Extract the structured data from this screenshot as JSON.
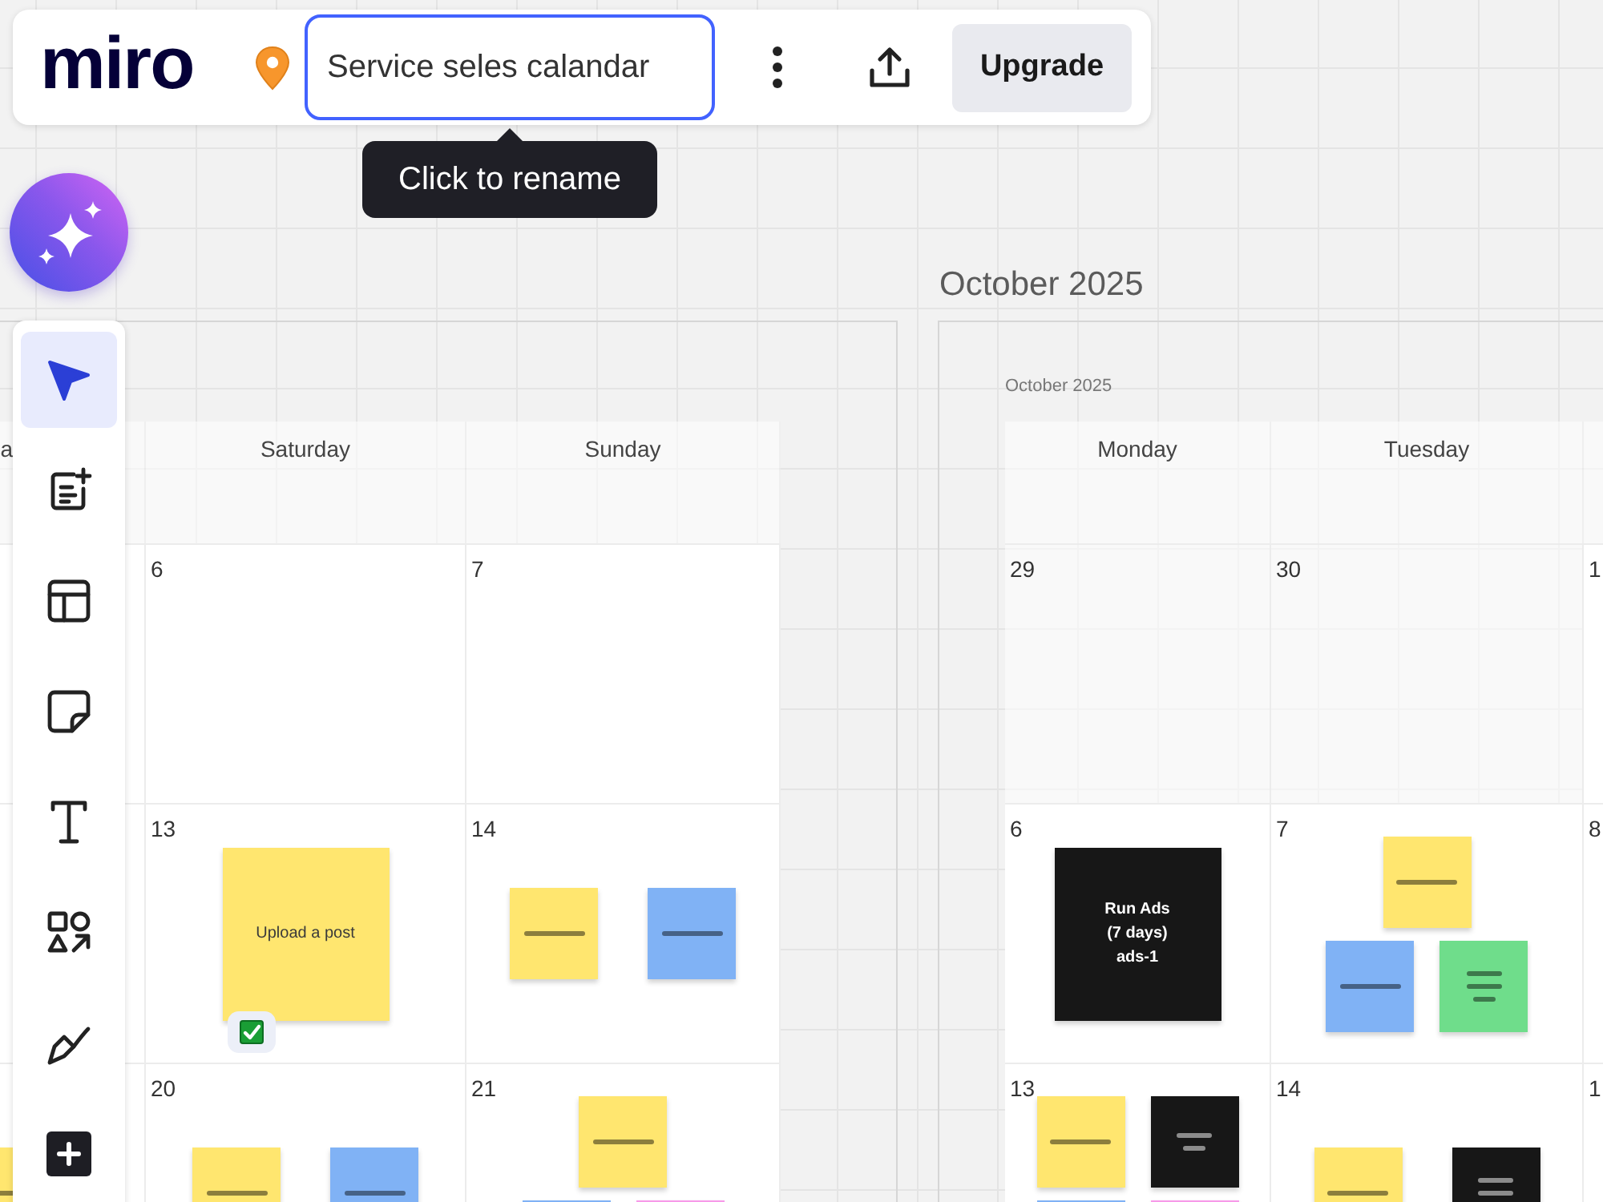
{
  "top_bar": {
    "logo": "miro",
    "board_title": "Service seles calandar",
    "upgrade_button": "Upgrade"
  },
  "tooltip": "Click to rename",
  "toolbar": [
    {
      "kind": "select",
      "selected": true
    },
    {
      "kind": "note",
      "selected": false
    },
    {
      "kind": "layout",
      "selected": false
    },
    {
      "kind": "sticky",
      "selected": false
    },
    {
      "kind": "text",
      "selected": false
    },
    {
      "kind": "shapes",
      "selected": false
    },
    {
      "kind": "pen",
      "selected": false
    },
    {
      "kind": "add",
      "selected": false
    }
  ],
  "frames": [
    {
      "columns": [
        {
          "header": "a"
        },
        {
          "header": "Saturday"
        },
        {
          "header": "Sunday"
        }
      ],
      "weeks": [
        [
          {
            "other_month": false
          },
          {
            "day": "6",
            "other_month": false
          },
          {
            "day": "7",
            "other_month": false
          }
        ],
        [
          {
            "other_month": false
          },
          {
            "day": "13",
            "other_month": false,
            "note_rows": [
              [
                {
                  "kind": "text",
                  "color": "#ffe66f",
                  "text": "Upload a post",
                  "checked": true
                }
              ]
            ]
          },
          {
            "day": "14",
            "other_month": false,
            "note_rows": [
              [
                {
                  "kind": "line",
                  "color": "#ffe66f",
                  "checked": false
                },
                {
                  "kind": "line",
                  "color": "#80b2f5",
                  "checked": false
                }
              ]
            ]
          }
        ],
        [
          {
            "other_month": false,
            "note_rows": [
              [
                {
                  "kind": "line",
                  "color": "#ffe66f",
                  "checked": false
                }
              ]
            ]
          },
          {
            "day": "20",
            "other_month": false,
            "note_rows": [
              [
                {
                  "kind": "line",
                  "color": "#ffe66f",
                  "checked": false
                },
                {
                  "kind": "line",
                  "color": "#80b2f5",
                  "checked": false
                }
              ]
            ]
          },
          {
            "day": "21",
            "other_month": false,
            "note_rows": [
              [
                {
                  "kind": "line",
                  "color": "#ffe66f",
                  "checked": false
                }
              ],
              [
                {
                  "kind": "plain",
                  "color": "#80b2f5",
                  "checked": false
                },
                {
                  "kind": "plain",
                  "color": "#f79ae9",
                  "checked": false
                }
              ]
            ]
          }
        ]
      ]
    },
    {
      "title": "October 2025",
      "label": "October 2025",
      "columns": [
        {
          "header": "Monday"
        },
        {
          "header": "Tuesday"
        },
        {}
      ],
      "weeks": [
        [
          {
            "day": "29",
            "other_month": true
          },
          {
            "day": "30",
            "other_month": true
          },
          {
            "day": "1",
            "other_month": false
          }
        ],
        [
          {
            "day": "6",
            "other_month": false,
            "note_rows": [
              [
                {
                  "kind": "text",
                  "color": "#171717",
                  "text": "Run Ads\n(7 days)\nads-1",
                  "checked": false
                }
              ]
            ]
          },
          {
            "day": "7",
            "other_month": false,
            "note_rows": [
              [
                {
                  "kind": "line",
                  "color": "#ffe66f",
                  "checked": false
                }
              ],
              [
                {
                  "kind": "line",
                  "color": "#80b2f5",
                  "checked": false
                },
                {
                  "kind": "three-lines",
                  "color": "#6fdd8b",
                  "checked": false
                }
              ]
            ]
          },
          {
            "day": "8",
            "other_month": false
          }
        ],
        [
          {
            "day": "13",
            "other_month": false,
            "note_rows": [
              [
                {
                  "kind": "line",
                  "color": "#ffe66f",
                  "checked": false
                },
                {
                  "kind": "two-lines",
                  "color": "#171717",
                  "checked": false
                }
              ],
              [
                {
                  "kind": "plain",
                  "color": "#80b2f5",
                  "checked": false
                },
                {
                  "kind": "plain",
                  "color": "#f79ae9",
                  "checked": false
                }
              ]
            ]
          },
          {
            "day": "14",
            "other_month": false,
            "note_rows": [
              [
                {
                  "kind": "line",
                  "color": "#ffe66f",
                  "checked": false
                },
                {
                  "kind": "three-lines",
                  "color": "#171717",
                  "checked": false
                }
              ]
            ]
          },
          {
            "day": "1",
            "other_month": false
          }
        ]
      ]
    }
  ]
}
